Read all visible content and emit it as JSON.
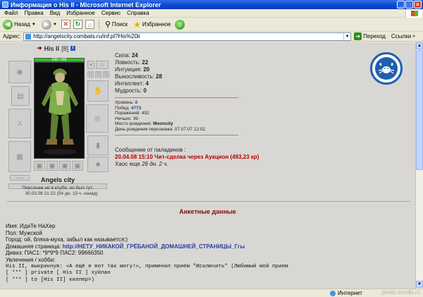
{
  "window": {
    "title": "Информация о His II - Microsoft Internet Explorer",
    "controls": [
      "_",
      "□",
      "×"
    ]
  },
  "menu": [
    "Файл",
    "Правка",
    "Вид",
    "Избранное",
    "Сервис",
    "Справка"
  ],
  "toolbar": {
    "back_label": "Назад",
    "search_label": "Поиск",
    "favorites_label": "Избранное"
  },
  "address": {
    "label": "Адрес:",
    "value": "http://angelscity.combats.ru/inf.pl?His%20ii",
    "go_label": "Переход",
    "links_label": "Ссылки"
  },
  "status": {
    "zone_label": "Интернет",
    "watermark": "photo.scrolls.ru"
  },
  "character": {
    "name": "His II",
    "level": "[8]",
    "hp_text": "248 / 248",
    "hp_fraction": 1.0,
    "city": "Angels city",
    "absent_note": "Персонаж не в клубе, но был тут:",
    "absent_time": "30.03.08 21:22 (54 дн. 15 ч. назад)"
  },
  "stats": [
    {
      "label": "Сила:",
      "value": "24"
    },
    {
      "label": "Ловкость:",
      "value": "22"
    },
    {
      "label": "Интуиция:",
      "value": "20"
    },
    {
      "label": "Выносливость:",
      "value": "28"
    },
    {
      "label": "Интеллект:",
      "value": "4"
    },
    {
      "label": "Мудрость:",
      "value": "0"
    }
  ],
  "details": {
    "level_label": "Уровень:",
    "level_value": "8",
    "wins_label": "Побед:",
    "wins_value": "4773",
    "losses_label": "Поражений:",
    "losses_value": "452",
    "draws_label": "Ничьих:",
    "draws_value": "39",
    "birthplace_label": "Место рождения:",
    "birthplace_value": "Mooncity",
    "birthday_label": "День рождения персонажа:",
    "birthday_value": "07.07.07 12:02"
  },
  "paladin": {
    "heading": "Сообщение от паладинов :",
    "message": "20.04.08 15:10 Чит-сделка через Аукцион (493,23 кр)",
    "chaos_prefix": "Хаос еще",
    "chaos_time": "26 дн. 2 ч."
  },
  "colors": {
    "accent_red": "#b40000",
    "link_blue": "#2b3f9b",
    "emblem_blue": "#1f5fb0"
  },
  "profile": {
    "title": "Анкетные данные",
    "name_line": "Имя: ИдиТе НаХер",
    "gender_line": "Пол: Мужской",
    "city_line": "Город: ой, бляха-муха, забыл как называется;)",
    "homepage_label": "Домашняя страница:",
    "homepage_value": "http://НЕТУ_НИКАКОЙ_ГРЁБАНОЙ_ДОМАШНЕЙ_СТРАНИЦЫ_Ггы",
    "motto_line": "Девиз: ПАС1: *9*9*9 ПАС2: 99666350",
    "hobbies_label": "Увлечения / хобби:",
    "hobby_lines": [
      "His II, выкрикнув: «А ещё я вот так могу!», применил прием \"Исключить\" (Любимый мой прием",
      "[  *** ] private [ His II ] хуйлан",
      "[  *** ] to [His II] киллер=)"
    ]
  }
}
